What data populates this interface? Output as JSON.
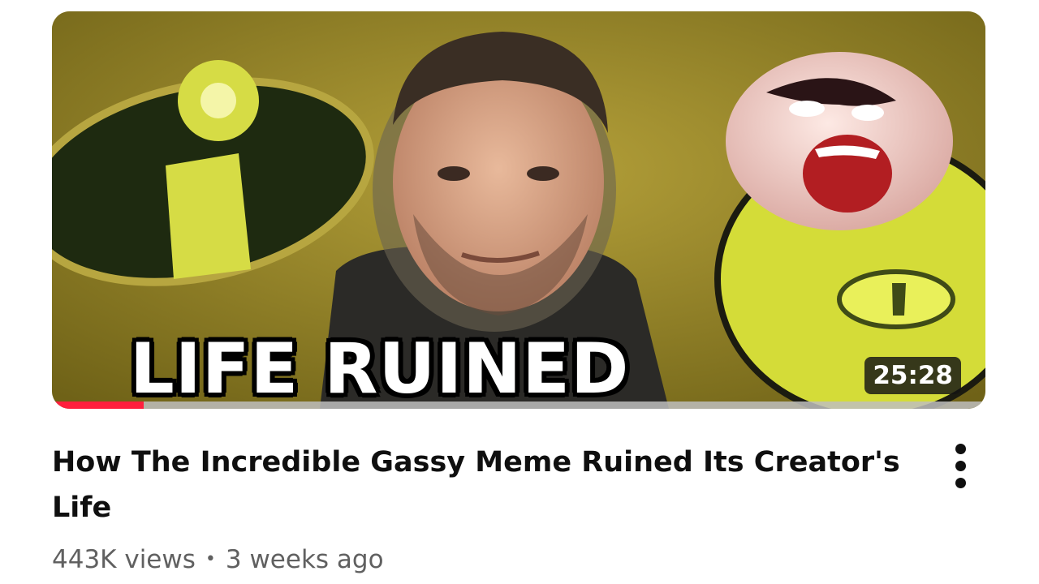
{
  "video": {
    "thumbnail_text": "LIFE RUINED",
    "duration": "25:28",
    "watch_progress": 0.098,
    "title": "How The Incredible Gassy Meme Ruined Its Creator's Life",
    "views": "443K views",
    "separator": "•",
    "age": "3 weeks ago",
    "menu_icon": "more-vert-icon"
  },
  "colors": {
    "progress": "#ff1f3d",
    "title": "#0f0f0f",
    "meta": "#606060",
    "thumb_background": "#8a7a22"
  }
}
